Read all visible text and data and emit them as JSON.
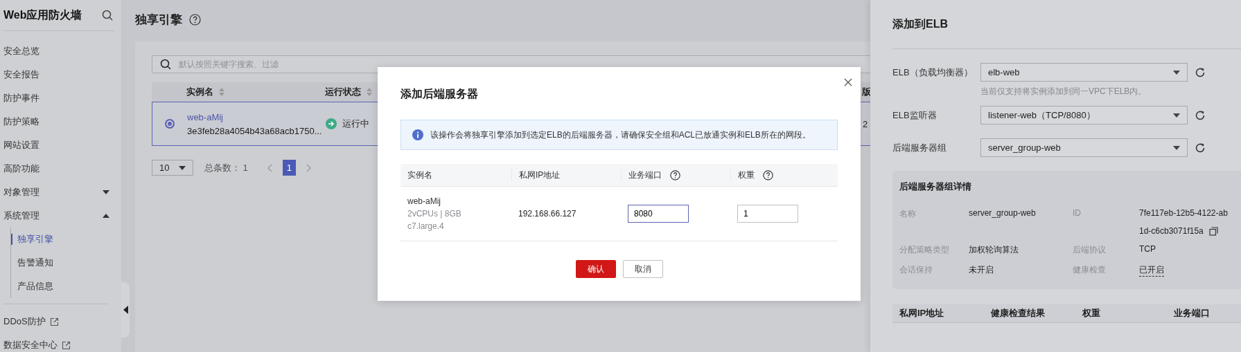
{
  "sidebar": {
    "title": "Web应用防火墙",
    "items": [
      {
        "kind": "page",
        "label": "安全总览",
        "selected": false
      },
      {
        "kind": "page",
        "label": "安全报告",
        "selected": false
      },
      {
        "kind": "page",
        "label": "防护事件",
        "selected": false
      },
      {
        "kind": "page",
        "label": "防护策略",
        "selected": false
      },
      {
        "kind": "page",
        "label": "网站设置",
        "selected": false
      },
      {
        "kind": "page",
        "label": "高阶功能",
        "selected": false
      },
      {
        "kind": "group",
        "label": "对象管理",
        "expanded": false
      },
      {
        "kind": "group",
        "label": "系统管理",
        "expanded": true,
        "children": [
          {
            "kind": "page",
            "label": "独享引擎",
            "selected": true
          },
          {
            "kind": "page",
            "label": "告警通知",
            "selected": false
          },
          {
            "kind": "page",
            "label": "产品信息",
            "selected": false
          }
        ]
      }
    ],
    "external_links": [
      {
        "label": "DDoS防护"
      },
      {
        "label": "数据安全中心"
      }
    ]
  },
  "page": {
    "title": "独享引擎",
    "search": {
      "placeholder": "默认按照关键字搜索、过滤"
    },
    "table": {
      "columns": [
        {
          "label": "实例名"
        },
        {
          "label": "运行状态"
        },
        {
          "label": "版"
        }
      ],
      "rows": [
        {
          "selected": true,
          "name": "web-aMij",
          "id": "3e3feb28a4054b43a68acb1750...",
          "status": "运行中",
          "column_3": "2"
        }
      ]
    },
    "pagination": {
      "page_size": "10",
      "total_label": "总条数：",
      "total": "1",
      "pages": [
        {
          "label": "1",
          "selected": true
        }
      ]
    }
  },
  "modal": {
    "title": "添加后端服务器",
    "notice": "该操作会将独享引擎添加到选定ELB的后端服务器，请确保安全组和ACL已放通实例和ELB所在的网段。",
    "columns": [
      {
        "label": "实例名"
      },
      {
        "label": "私网IP地址"
      },
      {
        "label": "业务端口",
        "help": true
      },
      {
        "label": "权重",
        "help": true
      }
    ],
    "rows": [
      {
        "name": "web-aMij",
        "spec": "2vCPUs | 8GB",
        "flavor": "c7.large.4",
        "ip": "192.168.66.127",
        "port": "8080",
        "port_focused": true,
        "weight": "1",
        "weight_focused": false
      }
    ],
    "buttons": [
      {
        "label": "确认",
        "kind": "primary"
      },
      {
        "label": "取消",
        "kind": "secondary"
      }
    ]
  },
  "drawer": {
    "title": "添加到ELB",
    "fields": [
      {
        "label": "ELB（负载均衡器）",
        "value": "elb-web",
        "hint": "当前仅支持将实例添加到同一VPC下ELB内。"
      },
      {
        "label": "ELB监听器",
        "value": "listener-web（TCP/8080）"
      },
      {
        "label": "后端服务器组",
        "value": "server_group-web"
      }
    ],
    "details": {
      "title": "后端服务器组详情",
      "items": [
        {
          "kind": "text",
          "label": "名称",
          "lines": [
            "server_group-web"
          ]
        },
        {
          "kind": "copy",
          "label": "ID",
          "lines": [
            "7fe117eb-12b5-4122-ab",
            "1d-c6cb3071f15a"
          ]
        },
        {
          "kind": "text",
          "label": "分配策略类型",
          "lines": [
            "加权轮询算法"
          ]
        },
        {
          "kind": "text",
          "label": "后端协议",
          "lines": [
            "TCP"
          ]
        },
        {
          "kind": "text",
          "label": "会话保持",
          "lines": [
            "未开启"
          ]
        },
        {
          "kind": "tip",
          "label": "健康检查",
          "lines": [
            "已开启"
          ]
        }
      ]
    },
    "table": {
      "columns": [
        {
          "label": "私网IP地址"
        },
        {
          "label": "健康检查结果"
        },
        {
          "label": "权重"
        },
        {
          "label": "业务端口"
        }
      ]
    }
  }
}
